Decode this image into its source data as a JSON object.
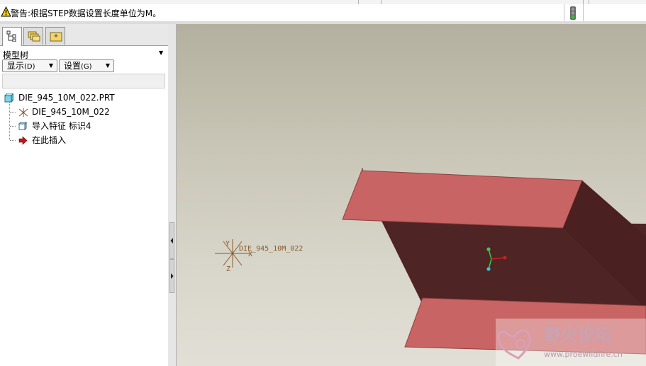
{
  "message_bar": {
    "warning_icon": "warning-triangle-icon",
    "text": "警告:根据STEP数据设置长度单位为M。",
    "status_light_icon": "traffic-light-icon"
  },
  "model_tree_panel": {
    "tabs": [
      {
        "name": "model-tree-tab",
        "icon": "tree-icon",
        "active": true
      },
      {
        "name": "folder-browser-tab",
        "icon": "folders-icon",
        "active": false
      },
      {
        "name": "favorites-tab",
        "icon": "star-folder-icon",
        "active": false
      }
    ],
    "title": "模型树",
    "show_button": {
      "label": "显示",
      "hotkey": "(D)"
    },
    "settings_button": {
      "label": "设置",
      "hotkey": "(G)"
    },
    "tree": {
      "root": "DIE_945_10M_022.PRT",
      "items": [
        {
          "label": "DIE_945_10M_022",
          "icon": "coordinate-system-icon"
        },
        {
          "label": "导入特征 标识4",
          "icon": "import-feature-icon"
        },
        {
          "label": "在此插入",
          "icon": "insert-here-arrow-icon"
        }
      ]
    }
  },
  "viewport": {
    "csys_label": "DIE_945_10M_022",
    "csys_axes": [
      "Y",
      "X",
      "Z"
    ],
    "watermark": {
      "title": "野火论坛",
      "url": "www.proewildfire.cn"
    },
    "colors": {
      "part_face_light": "#c96464",
      "part_face_dark": "#4e2424",
      "csys": "#8a5a2a"
    }
  }
}
